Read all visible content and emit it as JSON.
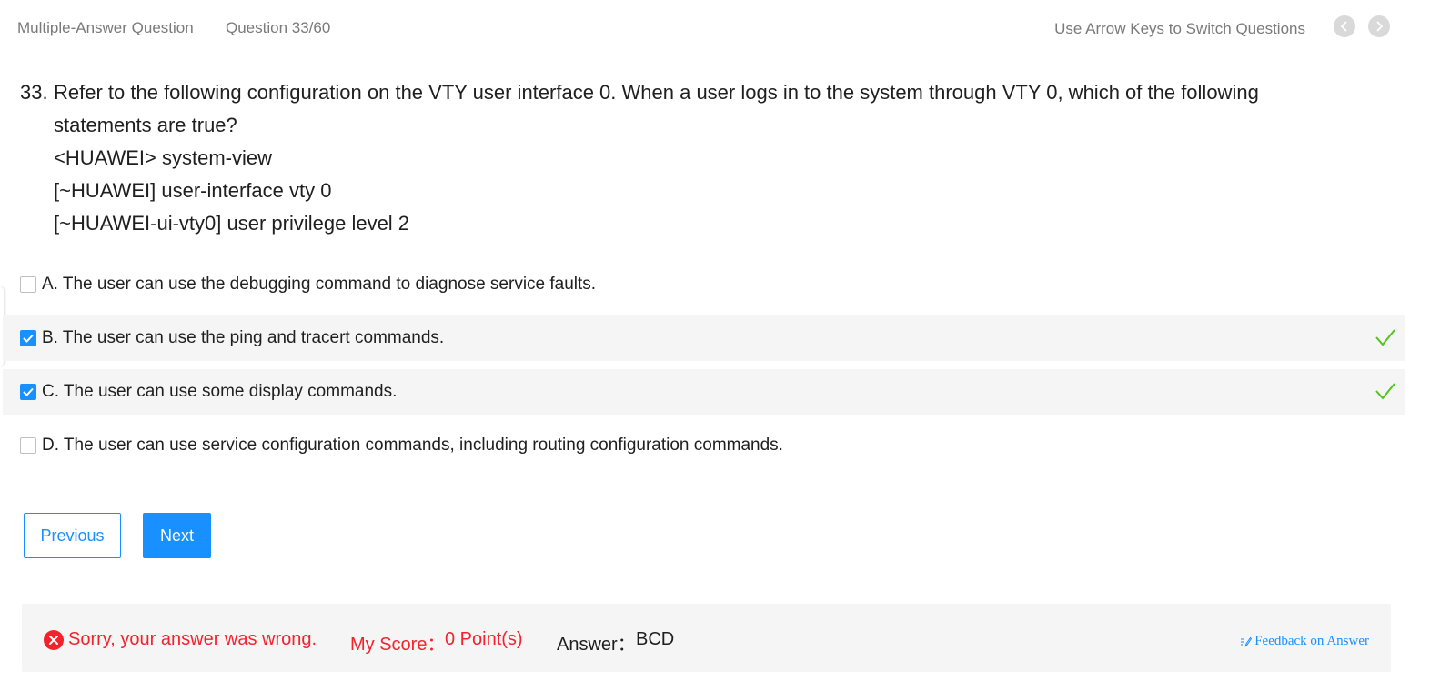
{
  "header": {
    "question_type": "Multiple-Answer Question",
    "question_counter": "Question 33/60",
    "nav_hint": "Use Arrow Keys to Switch Questions"
  },
  "question": {
    "number": "33.",
    "text": "Refer to the following configuration on the VTY user interface 0. When a user logs in to the system through VTY 0, which of the following statements are true?",
    "code_lines": [
      "<HUAWEI> system-view",
      "[~HUAWEI] user-interface vty 0",
      "[~HUAWEI-ui-vty0] user privilege level 2"
    ]
  },
  "options": [
    {
      "label": "A. The user can use the debugging command to diagnose service faults.",
      "checked": false,
      "correct_mark": false
    },
    {
      "label": "B. The user can use the ping and tracert commands.",
      "checked": true,
      "correct_mark": true
    },
    {
      "label": "C. The user can use some display commands.",
      "checked": true,
      "correct_mark": true
    },
    {
      "label": "D. The user can use service configuration commands, including routing configuration commands.",
      "checked": false,
      "correct_mark": false
    }
  ],
  "buttons": {
    "previous": "Previous",
    "next": "Next"
  },
  "result": {
    "wrong_text": "Sorry, your answer was wrong.",
    "score_label": "My Score：",
    "score_value": "0 Point(s)",
    "answer_label": "Answer：",
    "answer_value": "BCD",
    "feedback_label": "Feedback on Answer"
  },
  "colors": {
    "accent": "#1890ff",
    "error": "#f5222d",
    "correct": "#52c41a",
    "highlight_bg": "#f5f5f5"
  },
  "icons": {
    "prev_nav": "chevron-left-icon",
    "next_nav": "chevron-right-icon",
    "check": "checkmark-icon",
    "wrong": "close-circle-icon",
    "feedback": "edit-icon"
  }
}
